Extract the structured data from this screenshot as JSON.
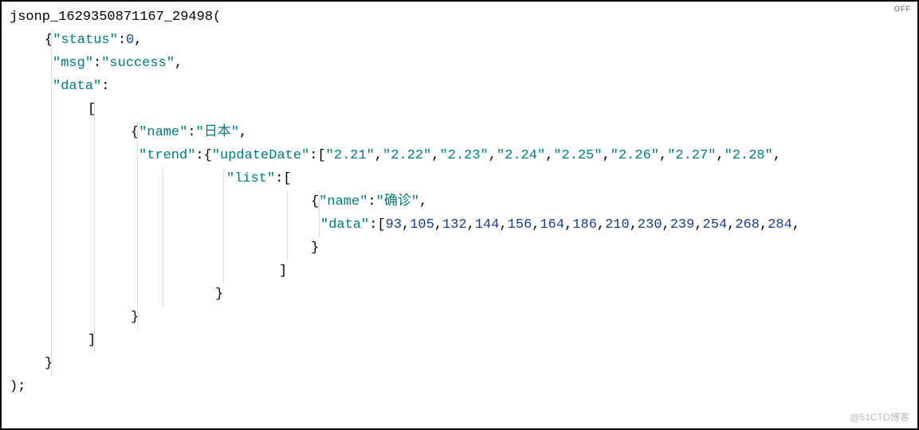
{
  "corner_label": "OFF",
  "watermark": "@51CTO博客",
  "code": {
    "jsonp_fn": "jsonp_1629350871167_29498",
    "status_key": "status",
    "status_val": "0",
    "msg_key": "msg",
    "msg_val": "success",
    "data_key": "data",
    "item_name_key": "name",
    "item_name_val": "日本",
    "trend_key": "trend",
    "updateDate_key": "updateDate",
    "updateDate_vals": [
      "2.21",
      "2.22",
      "2.23",
      "2.24",
      "2.25",
      "2.26",
      "2.27",
      "2.28"
    ],
    "list_key": "list",
    "list_item_name_key": "name",
    "list_item_name_val": "确诊",
    "list_item_data_key": "data",
    "list_item_data_vals": [
      "93",
      "105",
      "132",
      "144",
      "156",
      "164",
      "186",
      "210",
      "230",
      "239",
      "254",
      "268",
      "284"
    ]
  }
}
